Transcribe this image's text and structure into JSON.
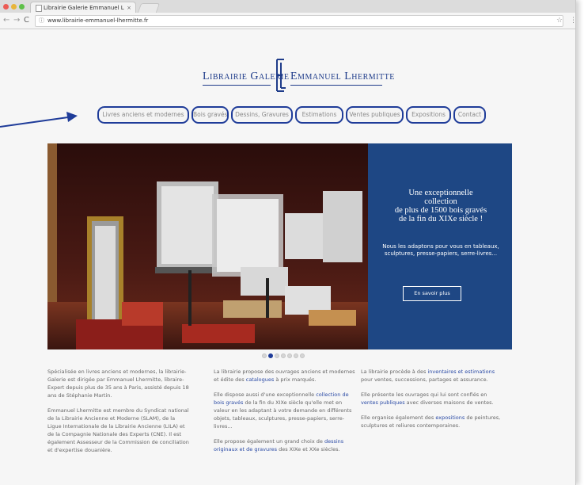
{
  "browser": {
    "tab_title": "Librairie Galerie Emmanuel L",
    "tab_close": "×",
    "url": "www.librairie-emmanuel-lhermitte.fr",
    "nav_back": "←",
    "nav_forward": "→",
    "nav_reload": "C",
    "info_icon": "ⓘ",
    "star_icon": "☆",
    "menu_icon": "⋮"
  },
  "logo": {
    "left_text": "Librairie Galerie",
    "right_text": "Emmanuel Lhermitte",
    "brand_color": "#1f3c8a"
  },
  "nav": {
    "items": [
      {
        "label": "Livres anciens et modernes"
      },
      {
        "label": "Bois gravés"
      },
      {
        "label": "Dessins, Gravures"
      },
      {
        "label": "Estimations"
      },
      {
        "label": "Ventes publiques"
      },
      {
        "label": "Expositions"
      },
      {
        "label": "Contact"
      }
    ],
    "highlight_color": "#1f3c99"
  },
  "hero": {
    "title_lines": [
      "Une exceptionnelle",
      "collection",
      "de plus de 1500 bois gravés",
      "de la fin du XIXe siècle !"
    ],
    "subtitle": "Nous les adaptons pour vous en tableaux, sculptures, presse-papiers, serre-livres...",
    "button_label": "En savoir plus",
    "panel_color": "#1e4784",
    "slide_count": 7,
    "active_slide": 1
  },
  "columns": [
    {
      "paragraphs": [
        {
          "text": "Spécialisée en livres anciens et modernes, la librairie-Galerie est dirigée par Emmanuel Lhermitte, libraire-Expert depuis plus de 35 ans à Paris, assisté depuis 18 ans de Stéphanie Martin."
        },
        {
          "text": "Emmanuel Lhermitte est membre du Syndicat national de la Librairie Ancienne et Moderne (SLAM), de la Ligue Internationale de la Librairie Ancienne (LILA) et de la Compagnie Nationale des Experts (CNE). Il est également Assesseur de la Commission de conciliation et d'expertise douanière."
        }
      ]
    },
    {
      "paragraphs": [
        {
          "pre": "La librairie propose des ouvrages anciens et modernes et édite des ",
          "link": "catalogues",
          "post": " à prix marqués."
        },
        {
          "pre": "Elle dispose aussi d'une exceptionnelle ",
          "link": "collection de bois gravés",
          "post": " de la fin du XIXe siècle qu'elle met en valeur en les adaptant à votre demande en différents objets, tableaux, sculptures, presse-papiers, serre-livres..."
        },
        {
          "pre": "Elle propose également un grand choix de ",
          "link": "dessins originaux et de gravures",
          "post": " des XIXe et XXe siècles."
        }
      ]
    },
    {
      "paragraphs": [
        {
          "pre": "La librairie procède à des ",
          "link": "inventaires et estimations",
          "post": " pour ventes, successions, partages et assurance."
        },
        {
          "pre": "Elle présente les ouvrages qui lui sont confiés en ",
          "link": "ventes publiques",
          "post": " avec diverses maisons de ventes."
        },
        {
          "pre": "Elle organise également des ",
          "link": "expositions",
          "post": " de peintures, sculptures et reliures contemporaines."
        }
      ]
    }
  ]
}
